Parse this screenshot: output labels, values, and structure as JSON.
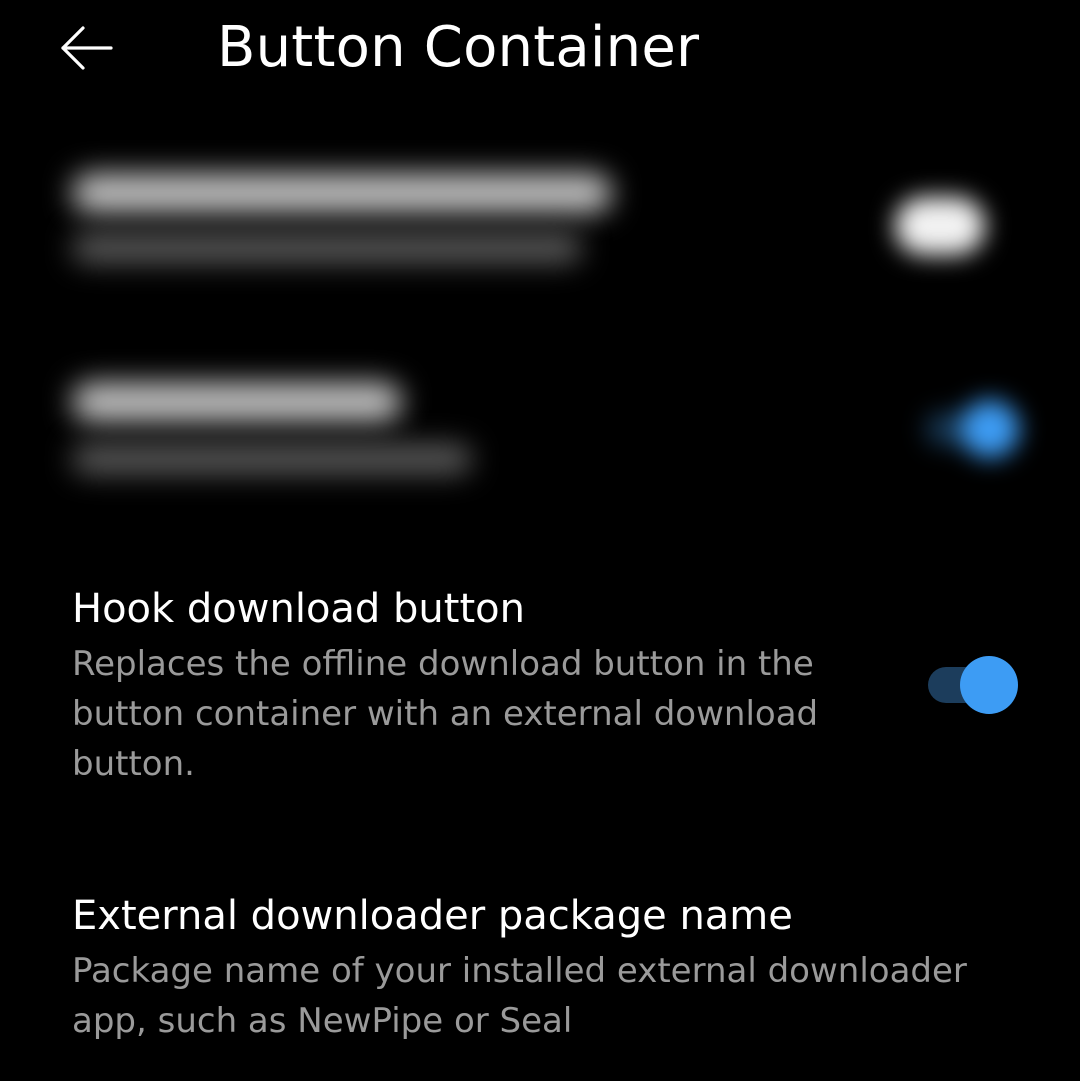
{
  "header": {
    "back_icon": "arrow-left-icon",
    "title": "Button Container"
  },
  "blurred_preferences": [
    {
      "switch_state": "off",
      "switch_color": "#f2f2f2"
    },
    {
      "switch_state": "on",
      "switch_color": "#3d9cf4"
    }
  ],
  "preferences": [
    {
      "title": "Hook download button",
      "summary": "Replaces the offline download button in the button container with an external download button.",
      "switch_state": "on"
    },
    {
      "title": "External downloader package name",
      "summary": "Package name of your installed external downloader app, such as NewPipe or Seal"
    }
  ],
  "colors": {
    "background": "#000000",
    "accent": "#3d9cf4",
    "track_on": "#1c3d5c",
    "summary_text": "#9a9a9a"
  }
}
